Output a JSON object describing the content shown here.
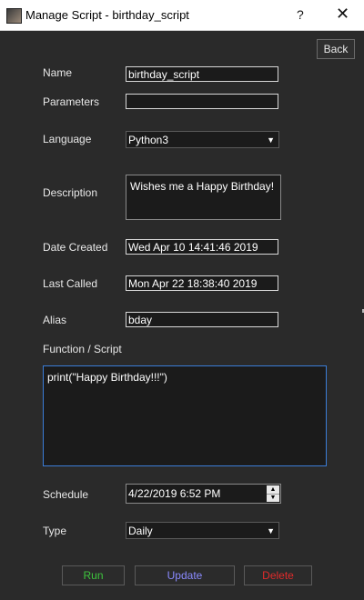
{
  "window": {
    "title": "Manage Script - birthday_script",
    "help": "?",
    "close": "✕"
  },
  "back_label": "Back",
  "fields": {
    "name": {
      "label": "Name",
      "value": "birthday_script"
    },
    "parameters": {
      "label": "Parameters",
      "value": ""
    },
    "language": {
      "label": "Language",
      "value": "Python3"
    },
    "description": {
      "label": "Description",
      "value": "Wishes me a Happy Birthday!"
    },
    "date_created": {
      "label": "Date Created",
      "value": "Wed Apr 10 14:41:46 2019"
    },
    "last_called": {
      "label": "Last Called",
      "value": "Mon Apr 22 18:38:40 2019"
    },
    "alias": {
      "label": "Alias",
      "value": "bday"
    },
    "script": {
      "label": "Function / Script",
      "value": "print(\"Happy Birthday!!!\")"
    },
    "schedule": {
      "label": "Schedule",
      "value": "4/22/2019 6:52 PM"
    },
    "type": {
      "label": "Type",
      "value": "Daily"
    }
  },
  "buttons": {
    "run": {
      "label": "Run",
      "color": "#3ec43e"
    },
    "update": {
      "label": "Update",
      "color": "#8a8aff"
    },
    "delete": {
      "label": "Delete",
      "color": "#e02b2b"
    }
  },
  "icons": {
    "app": "app-icon",
    "dropdown": "chevron-down-icon",
    "spin_up": "caret-up-icon",
    "spin_down": "caret-down-icon"
  }
}
